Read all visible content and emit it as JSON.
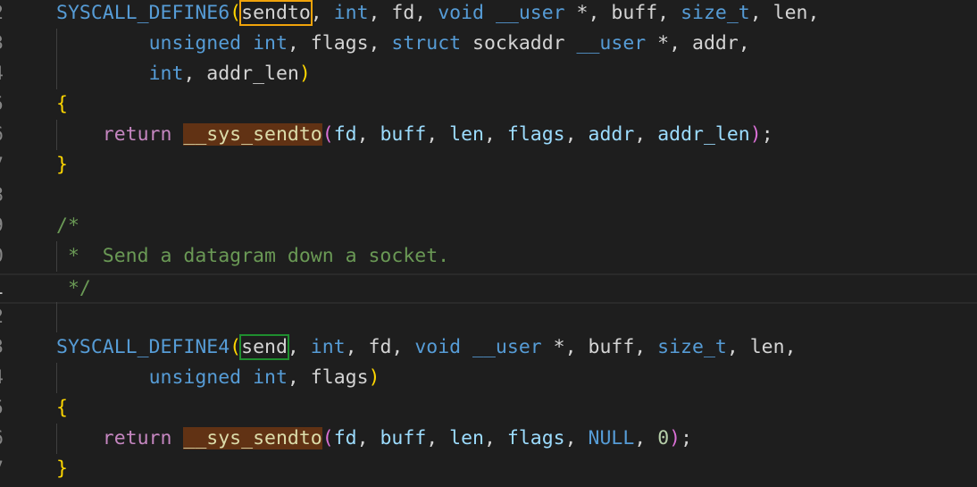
{
  "editor": {
    "lines": [
      {
        "num": "2",
        "tokens": [
          {
            "t": "SYSCALL_DEFINE6",
            "c": "t-macro"
          },
          {
            "t": "(",
            "c": "t-paren"
          },
          {
            "t": "sendto",
            "c": "t-plain",
            "box": "box-orange"
          },
          {
            "t": ", ",
            "c": "t-plain"
          },
          {
            "t": "int",
            "c": "t-type"
          },
          {
            "t": ", fd, ",
            "c": "t-plain"
          },
          {
            "t": "void",
            "c": "t-type"
          },
          {
            "t": " ",
            "c": "t-plain"
          },
          {
            "t": "__user",
            "c": "t-macro"
          },
          {
            "t": " *, buff, ",
            "c": "t-plain"
          },
          {
            "t": "size_t",
            "c": "t-type"
          },
          {
            "t": ", len,",
            "c": "t-plain"
          }
        ]
      },
      {
        "num": "3",
        "indent": 1,
        "tokens": [
          {
            "t": "        ",
            "c": "t-plain"
          },
          {
            "t": "unsigned",
            "c": "t-type"
          },
          {
            "t": " ",
            "c": "t-plain"
          },
          {
            "t": "int",
            "c": "t-type"
          },
          {
            "t": ", flags, ",
            "c": "t-plain"
          },
          {
            "t": "struct",
            "c": "t-kw"
          },
          {
            "t": " sockaddr ",
            "c": "t-plain"
          },
          {
            "t": "__user",
            "c": "t-macro"
          },
          {
            "t": " *, addr,",
            "c": "t-plain"
          }
        ]
      },
      {
        "num": "4",
        "indent": 1,
        "tokens": [
          {
            "t": "        ",
            "c": "t-plain"
          },
          {
            "t": "int",
            "c": "t-type"
          },
          {
            "t": ", addr_len",
            "c": "t-plain"
          },
          {
            "t": ")",
            "c": "t-paren"
          }
        ]
      },
      {
        "num": "5",
        "tokens": [
          {
            "t": "{",
            "c": "t-paren"
          }
        ]
      },
      {
        "num": "6",
        "indent": 1,
        "tokens": [
          {
            "t": "    ",
            "c": "t-plain"
          },
          {
            "t": "return",
            "c": "t-ctrl"
          },
          {
            "t": " ",
            "c": "t-plain"
          },
          {
            "t": "__sys_sendto",
            "c": "t-fn-hl"
          },
          {
            "t": "(",
            "c": "t-paren2"
          },
          {
            "t": "fd",
            "c": "t-param"
          },
          {
            "t": ", ",
            "c": "t-plain"
          },
          {
            "t": "buff",
            "c": "t-param"
          },
          {
            "t": ", ",
            "c": "t-plain"
          },
          {
            "t": "len",
            "c": "t-param"
          },
          {
            "t": ", ",
            "c": "t-plain"
          },
          {
            "t": "flags",
            "c": "t-param"
          },
          {
            "t": ", ",
            "c": "t-plain"
          },
          {
            "t": "addr",
            "c": "t-param"
          },
          {
            "t": ", ",
            "c": "t-plain"
          },
          {
            "t": "addr_len",
            "c": "t-param"
          },
          {
            "t": ")",
            "c": "t-paren2"
          },
          {
            "t": ";",
            "c": "t-plain"
          }
        ]
      },
      {
        "num": "7",
        "tokens": [
          {
            "t": "}",
            "c": "t-paren"
          }
        ]
      },
      {
        "num": "8",
        "tokens": []
      },
      {
        "num": "9",
        "tokens": [
          {
            "t": "/*",
            "c": "t-comment"
          }
        ]
      },
      {
        "num": "0",
        "indent": 0,
        "tokens": [
          {
            "t": " *  Send a datagram down a socket.",
            "c": "t-comment"
          }
        ]
      },
      {
        "num": "1",
        "current": true,
        "tokens": [
          {
            "t": " */",
            "c": "t-comment"
          }
        ]
      },
      {
        "num": "2",
        "indent": 0,
        "tokens": []
      },
      {
        "num": "3",
        "tokens": [
          {
            "t": "SYSCALL_DEFINE4",
            "c": "t-macro"
          },
          {
            "t": "(",
            "c": "t-paren"
          },
          {
            "t": "send",
            "c": "t-plain",
            "box": "box-green"
          },
          {
            "t": ", ",
            "c": "t-plain"
          },
          {
            "t": "int",
            "c": "t-type"
          },
          {
            "t": ", fd, ",
            "c": "t-plain"
          },
          {
            "t": "void",
            "c": "t-type"
          },
          {
            "t": " ",
            "c": "t-plain"
          },
          {
            "t": "__user",
            "c": "t-macro"
          },
          {
            "t": " *, buff, ",
            "c": "t-plain"
          },
          {
            "t": "size_t",
            "c": "t-type"
          },
          {
            "t": ", len,",
            "c": "t-plain"
          }
        ]
      },
      {
        "num": "4",
        "indent": 1,
        "tokens": [
          {
            "t": "        ",
            "c": "t-plain"
          },
          {
            "t": "unsigned",
            "c": "t-type"
          },
          {
            "t": " ",
            "c": "t-plain"
          },
          {
            "t": "int",
            "c": "t-type"
          },
          {
            "t": ", flags",
            "c": "t-plain"
          },
          {
            "t": ")",
            "c": "t-paren"
          }
        ]
      },
      {
        "num": "5",
        "tokens": [
          {
            "t": "{",
            "c": "t-paren"
          }
        ]
      },
      {
        "num": "6",
        "indent": 1,
        "tokens": [
          {
            "t": "    ",
            "c": "t-plain"
          },
          {
            "t": "return",
            "c": "t-ctrl"
          },
          {
            "t": " ",
            "c": "t-plain"
          },
          {
            "t": "__sys_sendto",
            "c": "t-fn-hl"
          },
          {
            "t": "(",
            "c": "t-paren2"
          },
          {
            "t": "fd",
            "c": "t-param"
          },
          {
            "t": ", ",
            "c": "t-plain"
          },
          {
            "t": "buff",
            "c": "t-param"
          },
          {
            "t": ", ",
            "c": "t-plain"
          },
          {
            "t": "len",
            "c": "t-param"
          },
          {
            "t": ", ",
            "c": "t-plain"
          },
          {
            "t": "flags",
            "c": "t-param"
          },
          {
            "t": ", ",
            "c": "t-plain"
          },
          {
            "t": "NULL",
            "c": "t-const"
          },
          {
            "t": ", ",
            "c": "t-plain"
          },
          {
            "t": "0",
            "c": "t-num"
          },
          {
            "t": ")",
            "c": "t-paren2"
          },
          {
            "t": ";",
            "c": "t-plain"
          }
        ]
      },
      {
        "num": "7",
        "tokens": [
          {
            "t": "}",
            "c": "t-paren"
          }
        ]
      }
    ]
  },
  "colors": {
    "background": "#1e1e1e",
    "highlight_box_first": "#f0a30a",
    "highlight_box_second": "#1f8f2f",
    "function_highlight": "#613214"
  }
}
